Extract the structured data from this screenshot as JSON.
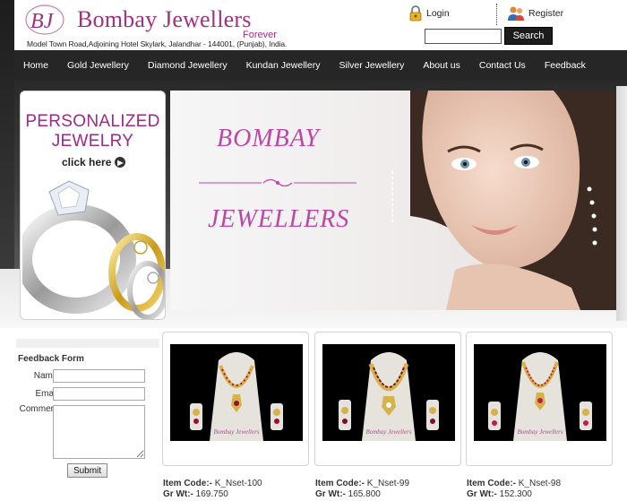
{
  "brand": {
    "monogram": "BJ",
    "name": "Bombay Jewellers",
    "tagline": "Forever",
    "address": "Model Town Road,Adjoining Hotel Skylark, Jalandhar - 144001, (Punjab), India.",
    "accent_color": "#a2307f"
  },
  "account": {
    "login_label": "Login",
    "login_icon": "padlock-icon",
    "register_label": "Register",
    "register_icon": "users-icon"
  },
  "search": {
    "value": "",
    "placeholder": "",
    "button_label": "Search"
  },
  "nav": {
    "items": [
      {
        "label": "Home"
      },
      {
        "label": "Gold Jewellery"
      },
      {
        "label": "Diamond Jewellery"
      },
      {
        "label": "Kundan Jewellery"
      },
      {
        "label": "Silver Jewellery"
      },
      {
        "label": "About us"
      },
      {
        "label": "Contact Us"
      },
      {
        "label": "Feedback"
      }
    ]
  },
  "promo": {
    "line1": "PERSONALIZED",
    "line2": "JEWELRY",
    "cta": "click here"
  },
  "hero": {
    "line1": "BOMBAY",
    "line2": "JEWELLERS"
  },
  "feedback_form": {
    "title": "Feedback Form",
    "name_label": "Name :",
    "email_label": "Email :",
    "comments_label": "Comments :",
    "submit_label": "Submit"
  },
  "products": [
    {
      "code_label": "Item Code:-",
      "code": "K_Nset-100",
      "wt_label": "Gr Wt:-",
      "weight": "169.750",
      "caption": "Bombay Jewellers"
    },
    {
      "code_label": "Item Code:-",
      "code": "K_Nset-99",
      "wt_label": "Gr Wt:-",
      "weight": "165.800",
      "caption": "Bombay Jewellers"
    },
    {
      "code_label": "Item Code:-",
      "code": "K_Nset-98",
      "wt_label": "Gr Wt:-",
      "weight": "152.300",
      "caption": "Bombay Jewellers"
    }
  ]
}
